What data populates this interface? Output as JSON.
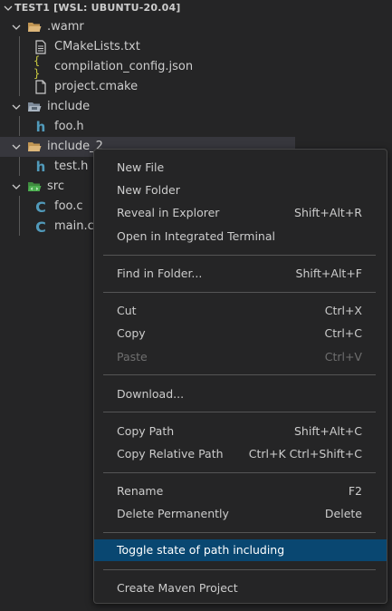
{
  "explorer": {
    "root_title": "TEST1 [WSL: UBUNTU-20.04]",
    "items": [
      {
        "label": ".wamr",
        "type": "folder"
      },
      {
        "label": "CMakeLists.txt",
        "type": "file"
      },
      {
        "label": "compilation_config.json",
        "type": "json"
      },
      {
        "label": "project.cmake",
        "type": "file"
      },
      {
        "label": "include",
        "type": "folder"
      },
      {
        "label": "foo.h",
        "type": "h"
      },
      {
        "label": "include_2",
        "type": "folder"
      },
      {
        "label": "test.h",
        "type": "h"
      },
      {
        "label": "src",
        "type": "folder"
      },
      {
        "label": "foo.c",
        "type": "c"
      },
      {
        "label": "main.c",
        "type": "c"
      }
    ],
    "icons": {
      "h_glyph": "h",
      "c_glyph": "C",
      "json_glyph": "{ }"
    }
  },
  "context_menu": {
    "items": [
      {
        "label": "New File",
        "shortcut": ""
      },
      {
        "label": "New Folder",
        "shortcut": ""
      },
      {
        "label": "Reveal in Explorer",
        "shortcut": "Shift+Alt+R"
      },
      {
        "label": "Open in Integrated Terminal",
        "shortcut": ""
      },
      {
        "label": "Find in Folder...",
        "shortcut": "Shift+Alt+F"
      },
      {
        "label": "Cut",
        "shortcut": "Ctrl+X"
      },
      {
        "label": "Copy",
        "shortcut": "Ctrl+C"
      },
      {
        "label": "Paste",
        "shortcut": "Ctrl+V"
      },
      {
        "label": "Download...",
        "shortcut": ""
      },
      {
        "label": "Copy Path",
        "shortcut": "Shift+Alt+C"
      },
      {
        "label": "Copy Relative Path",
        "shortcut": "Ctrl+K Ctrl+Shift+C"
      },
      {
        "label": "Rename",
        "shortcut": "F2"
      },
      {
        "label": "Delete Permanently",
        "shortcut": "Delete"
      },
      {
        "label": "Toggle state of path including",
        "shortcut": ""
      },
      {
        "label": "Create Maven Project",
        "shortcut": ""
      }
    ]
  },
  "colors": {
    "background": "#252526",
    "selected_row": "#37373d",
    "menu_highlight": "#094771",
    "folder": "#dcb67a",
    "file_icon": "#519aba",
    "json_icon": "#cbcb41"
  }
}
